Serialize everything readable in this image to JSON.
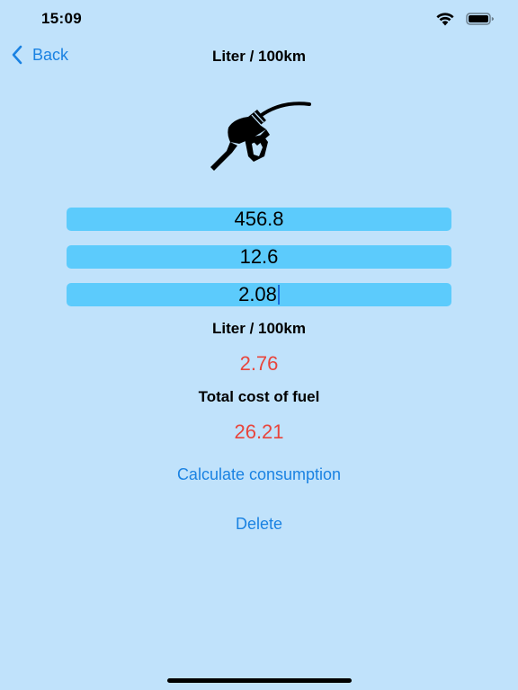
{
  "status": {
    "time": "15:09"
  },
  "nav": {
    "back_label": "Back",
    "title": "Liter / 100km"
  },
  "inputs": {
    "distance": "456.8",
    "fuel": "12.6",
    "price": "2.08"
  },
  "results": {
    "consumption_label": "Liter / 100km",
    "consumption_value": "2.76",
    "cost_label": "Total cost of fuel",
    "cost_value": "26.21"
  },
  "actions": {
    "calculate_label": "Calculate consumption",
    "delete_label": "Delete"
  },
  "colors": {
    "background": "#c0e2fb",
    "field": "#5ccbfc",
    "accent": "#1a82e2",
    "result": "#e8453c"
  }
}
